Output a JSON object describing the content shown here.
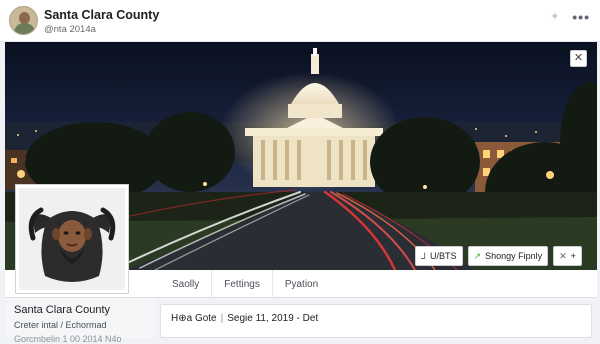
{
  "topbar": {
    "page_name": "Santa Clara County",
    "page_handle": "@nta 2014a",
    "more_label": "•••",
    "icons": [
      "pin-icon",
      "more-icon"
    ]
  },
  "cover": {
    "close_label": "✕",
    "buttons": [
      {
        "icon": "flag-icon",
        "icon_glyph": "⅃",
        "label": "U/BTS"
      },
      {
        "icon": "share-icon",
        "icon_glyph": "↗",
        "label": "Shongy Fipnly"
      },
      {
        "icon": "close-icon",
        "icon_glyph": "✕",
        "label": "+"
      }
    ]
  },
  "tabs": [
    {
      "label": "Saolly"
    },
    {
      "label": "Fettings"
    },
    {
      "label": "Pyation"
    }
  ],
  "left_info": {
    "name": "Santa Clara County",
    "subtitle": "Creter intal / Echormad",
    "cut_text": "Gorcmbelin 1 00 2014 N4o"
  },
  "post": {
    "title": "H⊕a Gote",
    "date": "Segie 11, 2019 - Det"
  },
  "colors": {
    "accent_green": "#42b72a",
    "background": "#f0f2f5",
    "border": "#dddfe2"
  }
}
